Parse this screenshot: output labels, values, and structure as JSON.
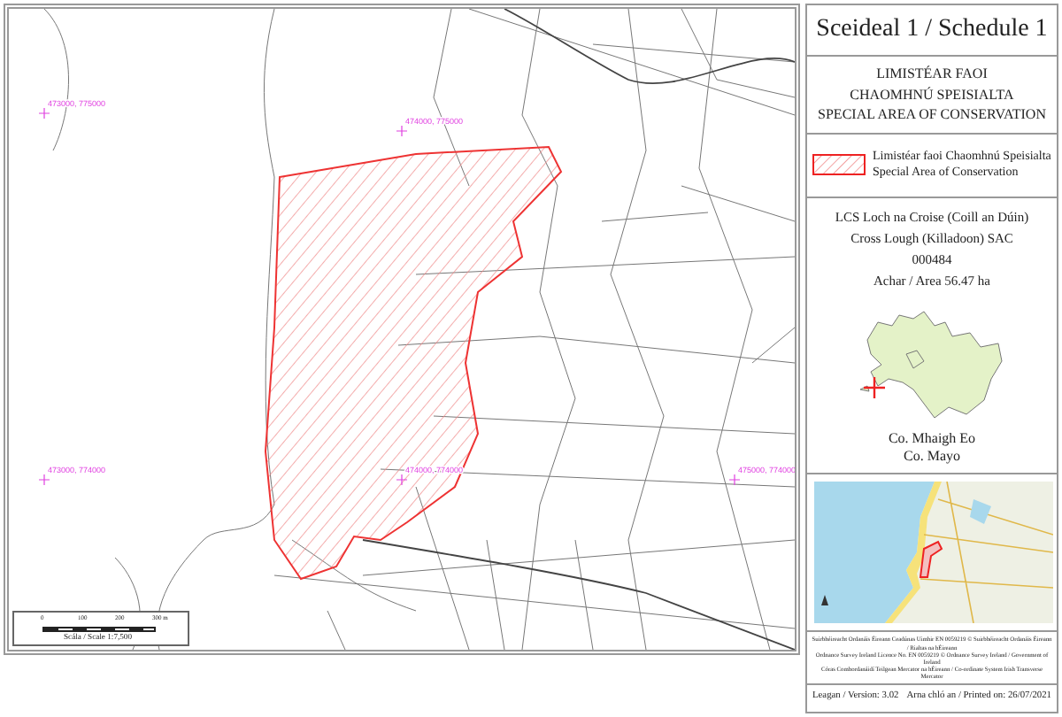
{
  "schedule_title": "Sceideal 1 / Schedule 1",
  "designation": [
    "LIMISTÉAR FAOI",
    "CHAOMHNÚ SPEISIALTA",
    "SPECIAL AREA OF CONSERVATION"
  ],
  "legend": {
    "label_ga": "Limistéar faoi Chaomhnú Speisialta",
    "label_en": "Special Area of Conservation"
  },
  "site": {
    "name_ga": "LCS Loch na Croise (Coill an Dúin)",
    "name_en": "Cross Lough (Killadoon) SAC",
    "code": "000484",
    "area": "Achar / Area 56.47 ha"
  },
  "county": {
    "name_ga": "Co. Mhaigh Eo",
    "name_en": "Co. Mayo"
  },
  "copyright": [
    "Suirbhéireacht Ordanáis Éireann Ceadúnas Uimhir EN 0059219 © Suirbhéireacht Ordanáis Éireann / Rialtas na hÉireann",
    "Ordnance Survey Ireland Licence No. EN 0059219 © Ordnance Survey Ireland / Government of Ireland",
    "Córas Comhordanáidí Teilgean Mercator na hÉireann / Co-ordinate System Irish Transverse Mercator"
  ],
  "version": "Leagan / Version: 3.02",
  "printed": "Arna chló an / Printed on: 26/07/2021",
  "map": {
    "grid_labels": [
      "473000, 775000",
      "474000, 775000",
      "473000, 774000",
      "474000, 774000",
      "475000, 774000"
    ],
    "scale_ticks": [
      "0",
      "100",
      "200",
      "300 m"
    ],
    "scale_text": "Scála / Scale 1:7,500"
  }
}
